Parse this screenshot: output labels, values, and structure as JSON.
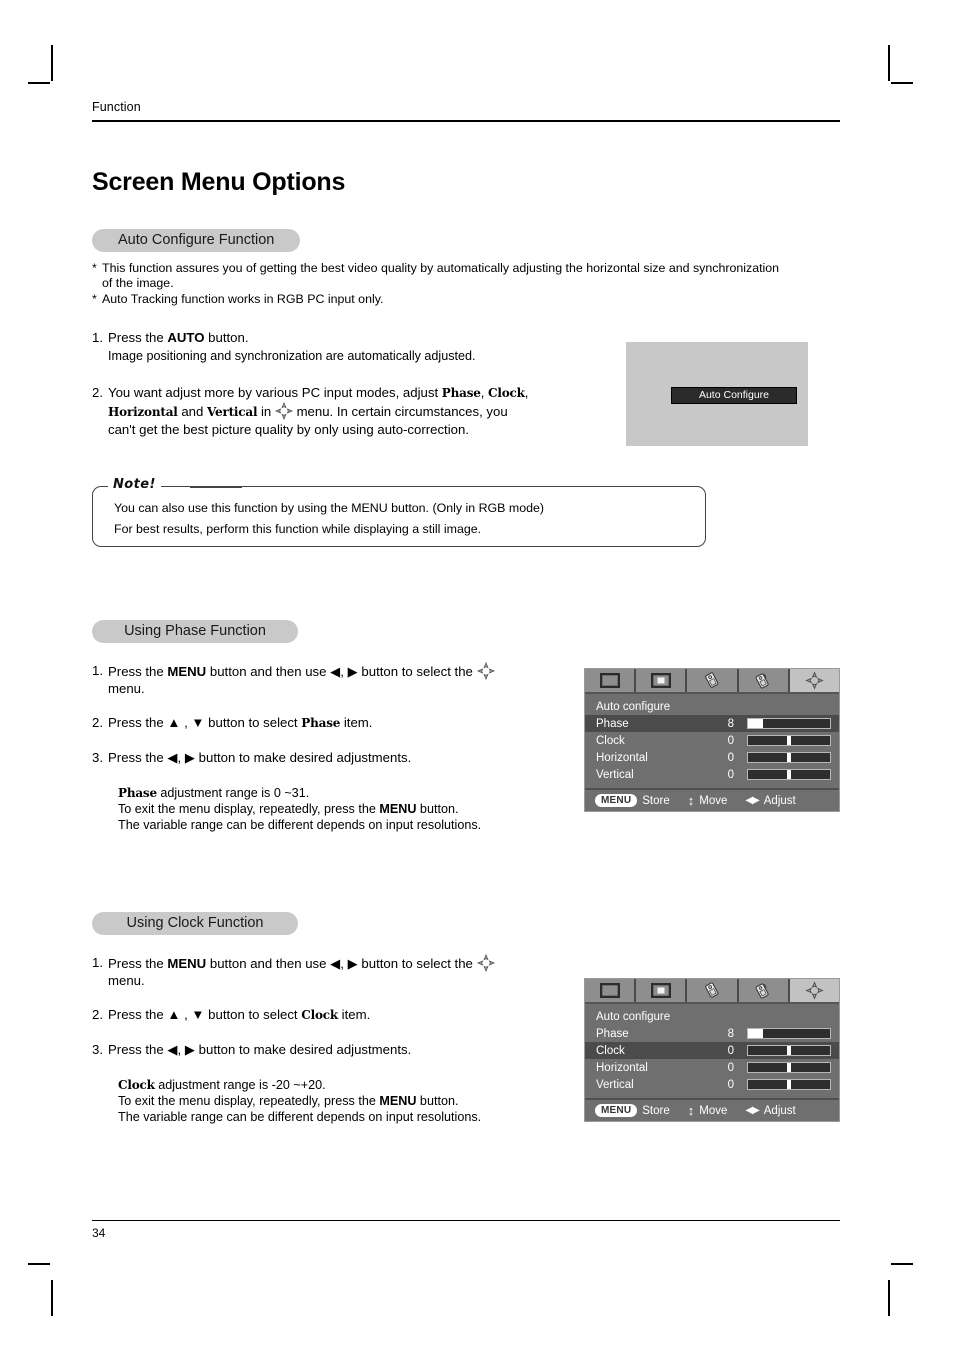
{
  "document": {
    "running_head": "Function",
    "title": "Screen Menu Options",
    "page_number": "34"
  },
  "auto_configure": {
    "heading": "Auto Configure Function",
    "bullets": [
      {
        "marker": "*",
        "line1": "This function assures you of getting the best video quality by automatically adjusting the horizontal size and synchronization",
        "line2": "of the image."
      },
      {
        "marker": "*",
        "line1": "Auto Tracking function works in RGB PC input only.",
        "line2": ""
      }
    ],
    "step1": {
      "num": "1.",
      "text_a": "Press the ",
      "bold": "AUTO",
      "text_b": " button.",
      "sub": "Image positioning and synchronization are automatically adjusted."
    },
    "step2": {
      "num": "2.",
      "line1_a": "You want adjust more by various PC input modes, adjust ",
      "line1_b": "Phase",
      "line1_c": ", ",
      "line1_d": "Clock",
      "line1_e": ",",
      "line2_a": "Horizontal",
      "line2_b": " and ",
      "line2_c": "Vertical",
      "line2_d": " in ",
      "line2_e": " menu. In certain circumstances, you",
      "line3": "can't get the best picture quality by only using auto-correction."
    },
    "illustration": {
      "button_label": "Auto Configure",
      "background_color": "#c8c8c8",
      "button_color": "#2b2b2b"
    }
  },
  "note": {
    "label": "Note!",
    "line1": "You can also use this function by using the MENU button. (Only in RGB mode)",
    "line2": "For best results, perform this function while displaying a still image."
  },
  "phase_section": {
    "heading": "Using Phase Function",
    "step1": {
      "num": "1.",
      "a": "Press the ",
      "bold": "MENU",
      "b": " button and then use ",
      "arrows": "◀, ▶",
      "c": " button to select the ",
      "line2": "menu."
    },
    "step2": {
      "num": "2.",
      "a": "Press the ",
      "arrows": "▲ , ▼",
      "b": " button to select ",
      "item": "Phase",
      "c": " item."
    },
    "step3": {
      "num": "3.",
      "a": "Press the  ",
      "arrows": "◀, ▶",
      "b": " button to make desired adjustments."
    },
    "notes": {
      "item": "Phase",
      "range_text": " adjustment range is 0 ~31.",
      "line2_a": "To exit the menu display, repeatedly, press the ",
      "line2_bold": "MENU",
      "line2_b": " button.",
      "line3": "The variable range can be different depends on input resolutions."
    }
  },
  "clock_section": {
    "heading": "Using Clock Function",
    "step1": {
      "num": "1.",
      "a": "Press the ",
      "bold": "MENU",
      "b": " button and then use ",
      "arrows": "◀, ▶",
      "c": " button to select the ",
      "line2": "menu."
    },
    "step2": {
      "num": "2.",
      "a": "Press the ",
      "arrows": "▲ , ▼",
      "b": " button to select ",
      "item": "Clock",
      "c": " item."
    },
    "step3": {
      "num": "3.",
      "a": "Press the  ",
      "arrows": "◀, ▶",
      "b": " button to make desired adjustments."
    },
    "notes": {
      "item": "Clock",
      "range_text": " adjustment range is -20 ~+20.",
      "line2_a": "To exit the menu display, repeatedly, press the ",
      "line2_bold": "MENU",
      "line2_b": " button.",
      "line3": "The variable range can be different depends on input resolutions."
    }
  },
  "osd_phase": {
    "tabs": [
      {
        "icon": "picture-icon",
        "active": false
      },
      {
        "icon": "screen-size-icon",
        "active": false
      },
      {
        "icon": "speaker-icon",
        "active": false
      },
      {
        "icon": "speaker-alt-icon",
        "active": false
      },
      {
        "icon": "screen-adjust-icon",
        "active": true
      }
    ],
    "header_item": "Auto configure",
    "rows": [
      {
        "label": "Phase",
        "value": "8",
        "fill_pct": 18,
        "knob_pct": 0,
        "style": "fill",
        "selected": true
      },
      {
        "label": "Clock",
        "value": "0",
        "fill_pct": 0,
        "knob_pct": 50,
        "style": "knob",
        "selected": false
      },
      {
        "label": "Horizontal",
        "value": "0",
        "fill_pct": 0,
        "knob_pct": 50,
        "style": "knob",
        "selected": false
      },
      {
        "label": "Vertical",
        "value": "0",
        "fill_pct": 0,
        "knob_pct": 50,
        "style": "knob",
        "selected": false
      }
    ],
    "footer": {
      "menu_chip": "MENU",
      "store": "Store",
      "move_arrows": "↕",
      "move": "Move",
      "adjust_arrows": "◀▶",
      "adjust": "Adjust"
    }
  },
  "osd_clock": {
    "tabs": [
      {
        "icon": "picture-icon",
        "active": false
      },
      {
        "icon": "screen-size-icon",
        "active": false
      },
      {
        "icon": "speaker-icon",
        "active": false
      },
      {
        "icon": "speaker-alt-icon",
        "active": false
      },
      {
        "icon": "screen-adjust-icon",
        "active": true
      }
    ],
    "header_item": "Auto configure",
    "rows": [
      {
        "label": "Phase",
        "value": "8",
        "fill_pct": 18,
        "knob_pct": 0,
        "style": "fill",
        "selected": false
      },
      {
        "label": "Clock",
        "value": "0",
        "fill_pct": 0,
        "knob_pct": 50,
        "style": "knob",
        "selected": true
      },
      {
        "label": "Horizontal",
        "value": "0",
        "fill_pct": 0,
        "knob_pct": 50,
        "style": "knob",
        "selected": false
      },
      {
        "label": "Vertical",
        "value": "0",
        "fill_pct": 0,
        "knob_pct": 50,
        "style": "knob",
        "selected": false
      }
    ],
    "footer": {
      "menu_chip": "MENU",
      "store": "Store",
      "move_arrows": "↕",
      "move": "Move",
      "adjust_arrows": "◀▶",
      "adjust": "Adjust"
    }
  }
}
